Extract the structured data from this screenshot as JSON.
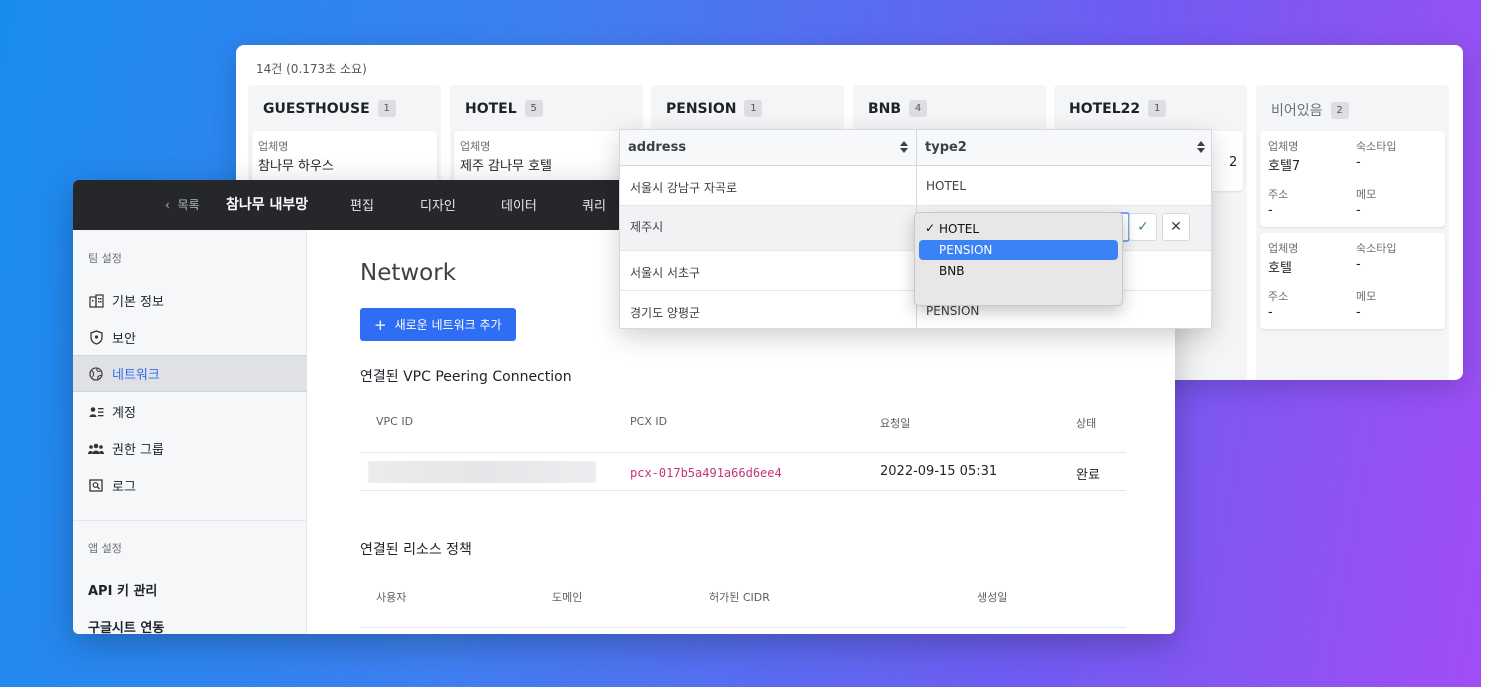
{
  "kanban": {
    "count": "14건 (0.173초 소요)",
    "columns": [
      {
        "name": "GUESTHOUSE",
        "count": "1",
        "label": "업체명",
        "value": "참나무 하우스"
      },
      {
        "name": "HOTEL",
        "count": "5",
        "label": "업체명",
        "value": "제주 감나무 호텔"
      },
      {
        "name": "PENSION",
        "count": "1"
      },
      {
        "name": "BNB",
        "count": "4"
      },
      {
        "name": "HOTEL22",
        "count": "1",
        "partial": "2"
      },
      {
        "name": "비어있음",
        "count": "2"
      }
    ],
    "empty_cards": [
      {
        "name_label": "업체명",
        "name_value": "호텔7",
        "type_label": "숙소타입",
        "type_value": "-",
        "addr_label": "주소",
        "addr_value": "-",
        "memo_label": "메모",
        "memo_value": "-"
      },
      {
        "name_label": "업체명",
        "name_value": "호텔",
        "type_label": "숙소타입",
        "type_value": "-",
        "addr_label": "주소",
        "addr_value": "-",
        "memo_label": "메모",
        "memo_value": "-"
      }
    ]
  },
  "nav": {
    "back": "목록",
    "title": "참나무 내부망",
    "items": [
      "편집",
      "디자인",
      "데이터",
      "쿼리"
    ]
  },
  "sidebar": {
    "team_section": "팀 설정",
    "team_items": [
      "기본 정보",
      "보안",
      "네트워크",
      "계정",
      "권한 그룹",
      "로그"
    ],
    "app_section": "앱 설정",
    "app_items": [
      "API 키 관리",
      "구글시트 연동"
    ]
  },
  "content": {
    "title": "Network",
    "add_button": "새로운 네트워크 추가",
    "vpc_section": "연결된 VPC Peering Connection",
    "vpc_headers": [
      "VPC ID",
      "PCX ID",
      "요청일",
      "상태"
    ],
    "vpc_row": {
      "pcx_id": "pcx-017b5a491a66d6ee4",
      "date": "2022-09-15 05:31",
      "status": "완료"
    },
    "policy_section": "연결된 리소스 정책",
    "policy_headers": [
      "사용자",
      "도메인",
      "허가된 CIDR",
      "생성일"
    ]
  },
  "grid": {
    "columns": [
      "address",
      "type2"
    ],
    "rows": [
      {
        "address": "서울시 강남구 자곡로",
        "type2": "HOTEL"
      },
      {
        "address": "제주시",
        "type2": ""
      },
      {
        "address": "서울시 서초구",
        "type2": ""
      },
      {
        "address": "경기도 양평군",
        "type2": "PENSION"
      }
    ],
    "dropdown": {
      "check": "✓",
      "options": [
        "HOTEL",
        "PENSION",
        "BNB"
      ],
      "selected": "HOTEL",
      "highlighted": "PENSION"
    }
  }
}
